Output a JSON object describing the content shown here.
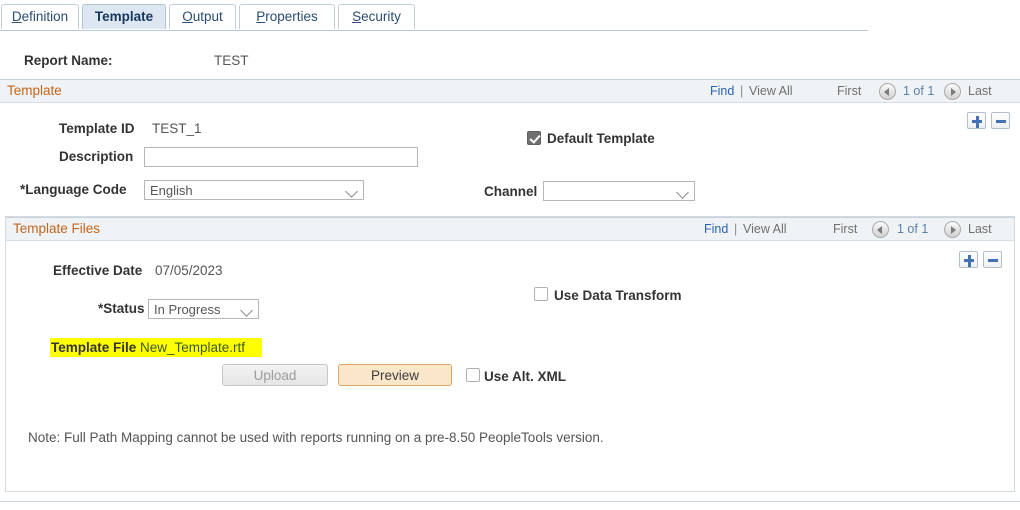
{
  "tabs": [
    {
      "label": "Definition",
      "accel": "D",
      "active": false
    },
    {
      "label": "Template",
      "accel": "T",
      "active": true
    },
    {
      "label": "Output",
      "accel": "O",
      "active": false
    },
    {
      "label": "Properties",
      "accel": "P",
      "active": false
    },
    {
      "label": "Security",
      "accel": "S",
      "active": false
    }
  ],
  "report": {
    "label": "Report Name:",
    "value": "TEST"
  },
  "template_section": {
    "title": "Template",
    "nav": {
      "find": "Find",
      "separator": "|",
      "view_all": "View All",
      "first": "First",
      "count": "1 of 1",
      "last": "Last"
    },
    "fields": {
      "template_id_label": "Template ID",
      "template_id_value": "TEST_1",
      "description_label": "Description",
      "description_value": "",
      "description_placeholder": "",
      "language_code_label": "*Language Code",
      "language_code_value": "English",
      "default_template_label": "Default Template",
      "default_template_checked": true,
      "channel_label": "Channel",
      "channel_value": ""
    }
  },
  "template_files_section": {
    "title": "Template Files",
    "nav": {
      "find": "Find",
      "separator": "|",
      "view_all": "View All",
      "first": "First",
      "count": "1 of 1",
      "last": "Last"
    },
    "fields": {
      "effective_date_label": "Effective Date",
      "effective_date_value": "07/05/2023",
      "status_label": "*Status",
      "status_value": "In Progress",
      "use_data_transform_label": "Use Data Transform",
      "use_data_transform_checked": false,
      "template_file_label": "Template File",
      "template_file_value": "New_Template.rtf",
      "upload_button": "Upload",
      "preview_button": "Preview",
      "use_alt_xml_label": "Use Alt. XML",
      "use_alt_xml_checked": false,
      "note": "Note: Full Path Mapping cannot be used with reports running on a pre-8.50 PeopleTools version."
    }
  },
  "colors": {
    "accent_orange": "#c4651a",
    "link_blue": "#2a62b6",
    "highlight_yellow": "#ffff00",
    "preview_button": "#fae7c9",
    "active_tab": "#dde7f1"
  }
}
